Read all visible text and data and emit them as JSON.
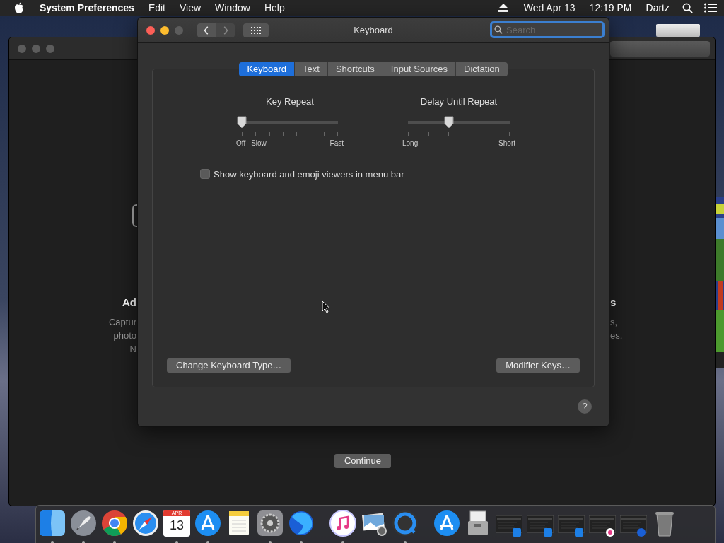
{
  "menu_bar": {
    "app": "System Preferences",
    "menus": [
      "Edit",
      "View",
      "Window",
      "Help"
    ],
    "date": "Wed Apr 13",
    "time": "12:19 PM",
    "user": "Dartz"
  },
  "background_window": {
    "left_texts": [
      {
        "text": "Ad",
        "kind": "heading"
      },
      {
        "text": "Captur",
        "kind": "body"
      },
      {
        "text": "photo",
        "kind": "body"
      },
      {
        "text": "N",
        "kind": "body"
      }
    ],
    "right_texts": [
      {
        "text": "s",
        "kind": "heading"
      },
      {
        "text": "s,",
        "kind": "body"
      },
      {
        "text": "es.",
        "kind": "body"
      }
    ],
    "continue_button": "Continue"
  },
  "window": {
    "title": "Keyboard",
    "controls": [
      {
        "kind": "close",
        "disabled": false
      },
      {
        "kind": "minimize",
        "disabled": false
      },
      {
        "kind": "zoom",
        "disabled": true
      }
    ],
    "nav": [
      {
        "kind": "back",
        "disabled": false
      },
      {
        "kind": "forward",
        "disabled": true
      }
    ],
    "search": {
      "placeholder": "Search"
    },
    "tabs": [
      {
        "label": "Keyboard",
        "selected": true
      },
      {
        "label": "Text",
        "selected": false
      },
      {
        "label": "Shortcuts",
        "selected": false
      },
      {
        "label": "Input Sources",
        "selected": false
      },
      {
        "label": "Dictation",
        "selected": false
      }
    ],
    "sliders": [
      {
        "title": "Key Repeat",
        "level": 0,
        "labels": [
          "Off",
          "Slow",
          "Fast"
        ]
      },
      {
        "title": "Delay Until Repeat",
        "level": 0.4,
        "labels": [
          "Long",
          "Short"
        ]
      }
    ],
    "checkbox": {
      "label": "Show keyboard and emoji viewers in menu bar",
      "checked": false
    },
    "buttons": [
      "Change Keyboard Type…",
      "Modifier Keys…"
    ],
    "help": "?"
  },
  "dock": [
    {
      "kind": "finder",
      "running": true
    },
    {
      "kind": "launchpad",
      "running": true
    },
    {
      "kind": "chrome",
      "running": true
    },
    {
      "kind": "safari",
      "running": false
    },
    {
      "kind": "calendar",
      "running": true,
      "month": "APR",
      "day": "13"
    },
    {
      "kind": "appstore",
      "running": true
    },
    {
      "kind": "notes",
      "running": false
    },
    {
      "kind": "settings",
      "running": true
    },
    {
      "kind": "firefox",
      "running": true
    },
    {
      "kind": "separator"
    },
    {
      "kind": "music",
      "running": true
    },
    {
      "kind": "preview",
      "running": false
    },
    {
      "kind": "quicktime",
      "running": true
    },
    {
      "kind": "separator"
    },
    {
      "kind": "appstore",
      "running": false
    },
    {
      "kind": "documents",
      "running": false
    },
    {
      "kind": "window"
    },
    {
      "kind": "window"
    },
    {
      "kind": "window"
    },
    {
      "kind": "musicwindow"
    },
    {
      "kind": "browserwindow"
    },
    {
      "kind": "trash",
      "running": false
    }
  ]
}
